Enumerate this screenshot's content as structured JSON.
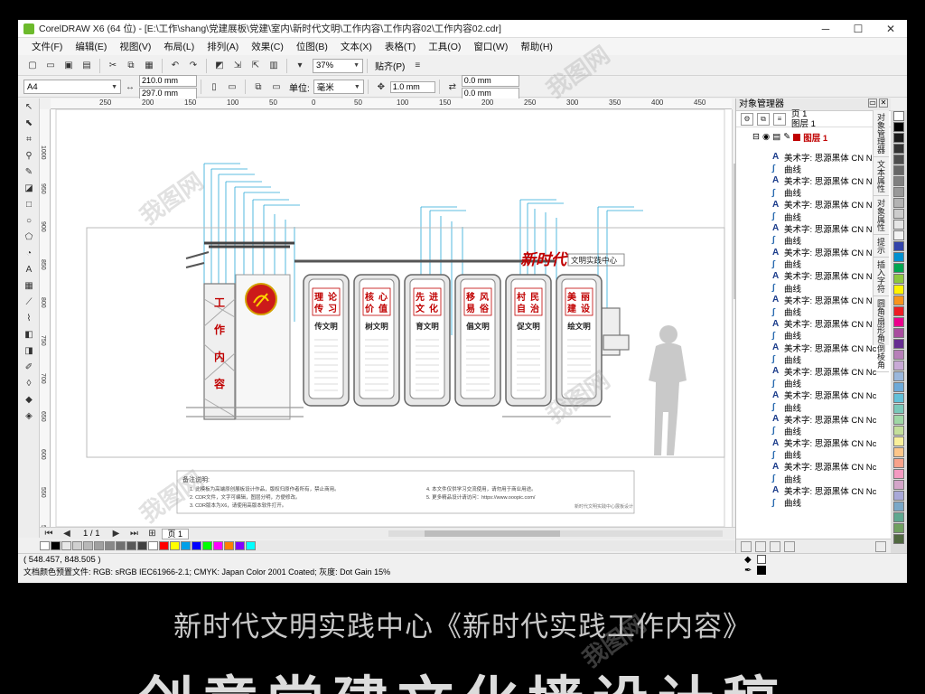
{
  "window": {
    "title": "CorelDRAW X6 (64 位) - [E:\\工作\\shang\\党建展板\\党建\\室内\\新时代文明\\工作内容\\工作内容02\\工作内容02.cdr]",
    "minimize": "─",
    "maximize": "☐",
    "close": "✕"
  },
  "menu": [
    "文件(F)",
    "编辑(E)",
    "视图(V)",
    "布局(L)",
    "排列(A)",
    "效果(C)",
    "位图(B)",
    "文本(X)",
    "表格(T)",
    "工具(O)",
    "窗口(W)",
    "帮助(H)"
  ],
  "toolbar1": {
    "zoom": "37%",
    "snap_label": "贴齐(P)"
  },
  "toolbar2": {
    "page_size": "A4",
    "width": "210.0 mm",
    "height": "297.0 mm",
    "units_label": "单位:",
    "units_value": "毫米",
    "nudge": "1.0 mm",
    "dup_x": "0.0 mm",
    "dup_y": "0.0 mm"
  },
  "ruler": {
    "h_ticks": [
      "250",
      "200",
      "150",
      "100",
      "50",
      "0",
      "50",
      "100",
      "150",
      "200",
      "250",
      "300",
      "350",
      "400",
      "450"
    ],
    "v_ticks": [
      "1000",
      "950",
      "900",
      "850",
      "800",
      "750",
      "700",
      "650",
      "600",
      "550",
      "500"
    ]
  },
  "artwork": {
    "title_big": "新时代",
    "title_small": "文明实践中心",
    "side_chars": [
      "工",
      "作",
      "内",
      "容"
    ],
    "panels": [
      {
        "red": [
          "理",
          "传",
          "论",
          "习"
        ],
        "black": "传文明"
      },
      {
        "red": [
          "核",
          "价",
          "心",
          "值"
        ],
        "black": "树文明"
      },
      {
        "red": [
          "先",
          "文",
          "进",
          "化"
        ],
        "black": "育文明"
      },
      {
        "red": [
          "移",
          "易",
          "风",
          "俗"
        ],
        "black": "倡文明"
      },
      {
        "red": [
          "村",
          "自",
          "民",
          "治"
        ],
        "black": "促文明"
      },
      {
        "red": [
          "美",
          "建",
          "丽",
          "设"
        ],
        "black": "绘文明"
      }
    ],
    "notes_title": "备注说明:",
    "notes_left": [
      "1. 此模板为高端原创展板设计作品，版权归原作者所有，禁止商用。",
      "2. CDR文件，文字可编辑，图层分明，方便修改。",
      "3. CDR版本为X6，请使用高版本软件打开。"
    ],
    "notes_right": [
      "4. 本文件仅供学习交流使用，请勿用于商业用途。",
      "5. 更多精品设计请访问：https://www.ooopic.com/"
    ],
    "notes_footer": "新时代文明实践中心展板设计"
  },
  "pagebar": {
    "position": "1 / 1",
    "page_tab": "页 1"
  },
  "status": {
    "coords": "( 548.457, 848.505 )",
    "color_profile": "文档颜色预置文件: RGB: sRGB IEC61966-2.1; CMYK: Japan Color 2001 Coated; 灰度: Dot Gain 15%"
  },
  "object_manager": {
    "title": "对象管理器",
    "page": "页 1",
    "layer_label": "图层 1",
    "layer_name": "图层 1",
    "rows": [
      {
        "type": "text",
        "label": "美术字: 思源黑体 CN Nc"
      },
      {
        "type": "curve",
        "label": "曲线"
      },
      {
        "type": "text",
        "label": "美术字: 思源黑体 CN Nc"
      },
      {
        "type": "curve",
        "label": "曲线"
      },
      {
        "type": "text",
        "label": "美术字: 思源黑体 CN Nc"
      },
      {
        "type": "curve",
        "label": "曲线"
      },
      {
        "type": "text",
        "label": "美术字: 思源黑体 CN Nc"
      },
      {
        "type": "curve",
        "label": "曲线"
      },
      {
        "type": "text",
        "label": "美术字: 思源黑体 CN Nc"
      },
      {
        "type": "curve",
        "label": "曲线"
      },
      {
        "type": "text",
        "label": "美术字: 思源黑体 CN Nc"
      },
      {
        "type": "curve",
        "label": "曲线"
      },
      {
        "type": "text",
        "label": "美术字: 思源黑体 CN Nc"
      },
      {
        "type": "curve",
        "label": "曲线"
      },
      {
        "type": "text",
        "label": "美术字: 思源黑体 CN Nc"
      },
      {
        "type": "curve",
        "label": "曲线"
      },
      {
        "type": "text",
        "label": "美术字: 思源黑体 CN Nc"
      },
      {
        "type": "curve",
        "label": "曲线"
      },
      {
        "type": "text",
        "label": "美术字: 思源黑体 CN Nc"
      },
      {
        "type": "curve",
        "label": "曲线"
      },
      {
        "type": "text",
        "label": "美术字: 思源黑体 CN Nc"
      },
      {
        "type": "curve",
        "label": "曲线"
      },
      {
        "type": "text",
        "label": "美术字: 思源黑体 CN Nc"
      },
      {
        "type": "curve",
        "label": "曲线"
      },
      {
        "type": "text",
        "label": "美术字: 思源黑体 CN Nc"
      },
      {
        "type": "curve",
        "label": "曲线"
      },
      {
        "type": "text",
        "label": "美术字: 思源黑体 CN Nc"
      },
      {
        "type": "curve",
        "label": "曲线"
      },
      {
        "type": "text",
        "label": "美术字: 思源黑体 CN Nc"
      },
      {
        "type": "curve",
        "label": "曲线"
      }
    ]
  },
  "side_tabs": [
    "对象管理器",
    "文本属性",
    "对象属性",
    "提示",
    "插入字符",
    "圆角/扇形角/倒棱角"
  ],
  "palette_colors": [
    "#ffffff",
    "#000000",
    "#e8e8e8",
    "#d0d0d0",
    "#b8b8b8",
    "#a0a0a0",
    "#888888",
    "#707070",
    "#585858",
    "#404040",
    "#ffffff",
    "#ff0000",
    "#ffff00",
    "#00a0e9",
    "#0000ff",
    "#00ff00",
    "#ff00ff",
    "#ff8000",
    "#8000ff",
    "#00ffff"
  ],
  "right_palette": [
    "#ffffff",
    "#000000",
    "#1a1a1a",
    "#333333",
    "#4d4d4d",
    "#666666",
    "#808080",
    "#999999",
    "#b3b3b3",
    "#cccccc",
    "#e6e6e6",
    "#f2f2f2",
    "#3344aa",
    "#0090d0",
    "#00a650",
    "#8dc63f",
    "#fff200",
    "#f7941d",
    "#ed1c24",
    "#ec008c",
    "#a94c9f",
    "#662d91",
    "#b77fb9",
    "#c8a9d6",
    "#9ab7dc",
    "#6da9d8",
    "#62c0d9",
    "#7ac8b9",
    "#9fd7a5",
    "#c4df9b",
    "#f9ef9a",
    "#fdc68a",
    "#f9a28a",
    "#f49ac1",
    "#d4a5c9",
    "#a8a8d8",
    "#7aa8c8",
    "#5fa890",
    "#70a060",
    "#506840"
  ],
  "captions": {
    "line1": "新时代文明实践中心《新时代实践工作内容》",
    "line2": "创意党建文化墙设计稿"
  },
  "watermark": "我图网"
}
